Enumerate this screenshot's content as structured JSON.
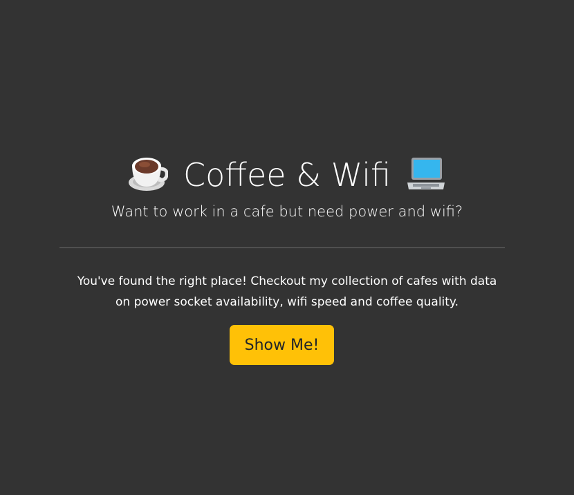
{
  "hero": {
    "title": "Coffee & Wifi",
    "title_left_icon": "coffee-cup-icon",
    "title_right_icon": "laptop-icon",
    "subtitle": "Want to work in a cafe but need power and wifi?",
    "lead_line1": "You've found the right place! Checkout my collection of cafes with data",
    "lead_line2": "on power socket availability, wifi speed and coffee quality.",
    "button_label": "Show Me!"
  },
  "colors": {
    "background": "#333333",
    "text": "#ffffff",
    "button": "#ffc107",
    "button_text": "#212529",
    "divider": "#6c6c6c"
  }
}
